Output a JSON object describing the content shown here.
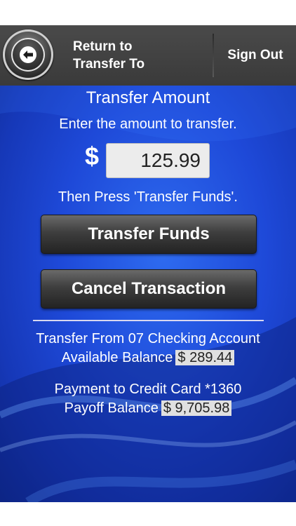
{
  "header": {
    "return_label_line1": "Return to",
    "return_label_line2": "Transfer To",
    "sign_out_label": "Sign Out"
  },
  "transfer": {
    "title": "Transfer Amount",
    "instruction": "Enter the amount to transfer.",
    "currency_symbol": "$",
    "amount_value": "125.99",
    "then_instruction": "Then Press 'Transfer Funds'.",
    "transfer_button_label": "Transfer Funds",
    "cancel_button_label": "Cancel Transaction"
  },
  "accounts": {
    "from_label": "Transfer From 07 Checking Account",
    "available_label": "Available Balance",
    "available_amount": "$ 289.44",
    "payment_label": "Payment to Credit Card *1360",
    "payoff_label": "Payoff Balance",
    "payoff_amount": "$ 9,705.98"
  },
  "colors": {
    "header_bg": "#404040",
    "main_bg": "#1e49d8",
    "button_bg": "#333333"
  }
}
